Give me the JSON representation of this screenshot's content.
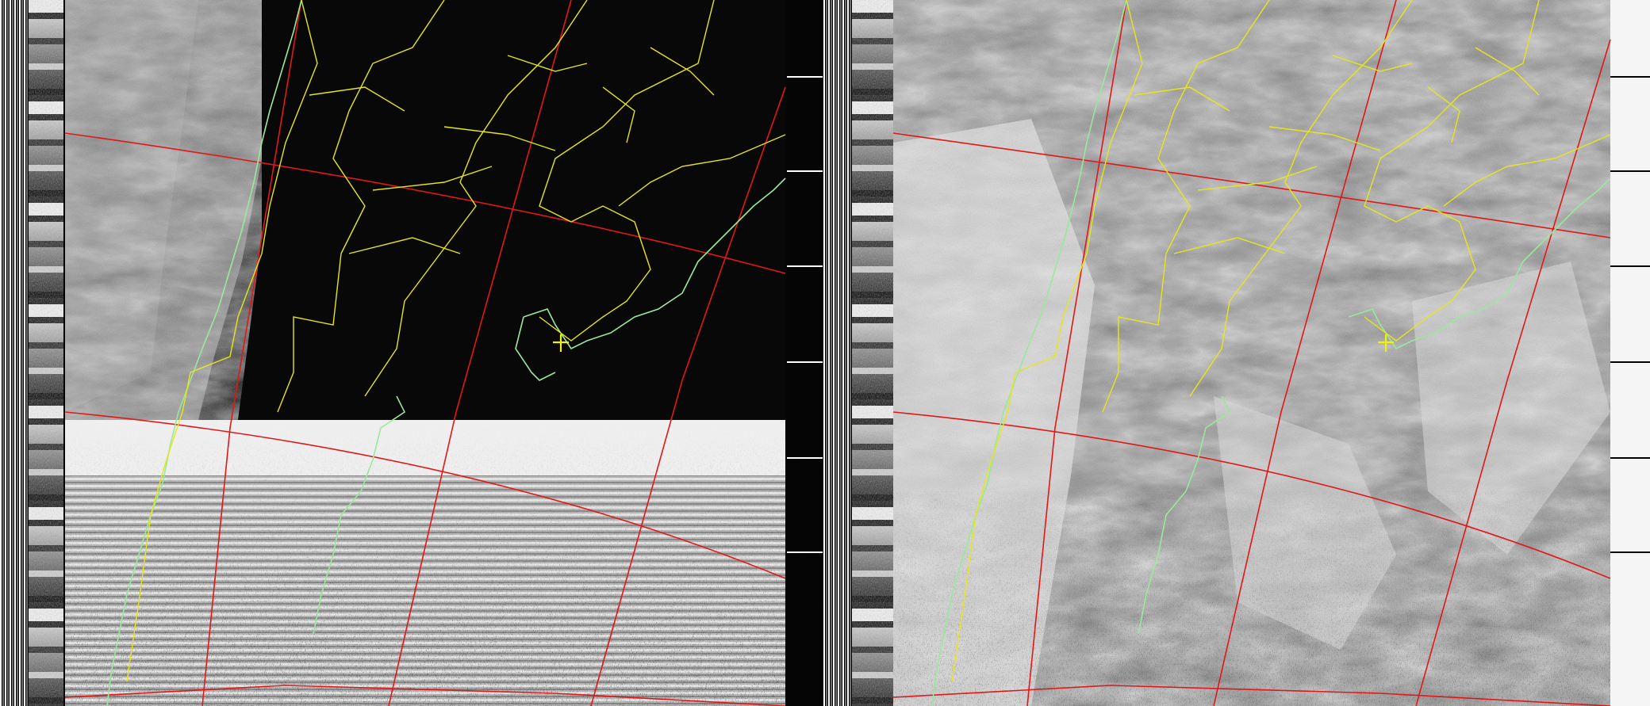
{
  "image": {
    "kind": "NOAA APT weather satellite image with map overlay",
    "channels": [
      "channel-a-visible",
      "channel-b-infrared"
    ],
    "palette": {
      "background": "#000000",
      "coastline": "#9ae89a",
      "borders": "#e6e619",
      "graticule": "#e01818",
      "marker": "#f2f200",
      "ground_dark": "#0c0c0c",
      "noise_light": "#e8e8e8",
      "ir_gray": "#8a8a8a"
    },
    "marker_icon": "plus-marker-icon"
  }
}
